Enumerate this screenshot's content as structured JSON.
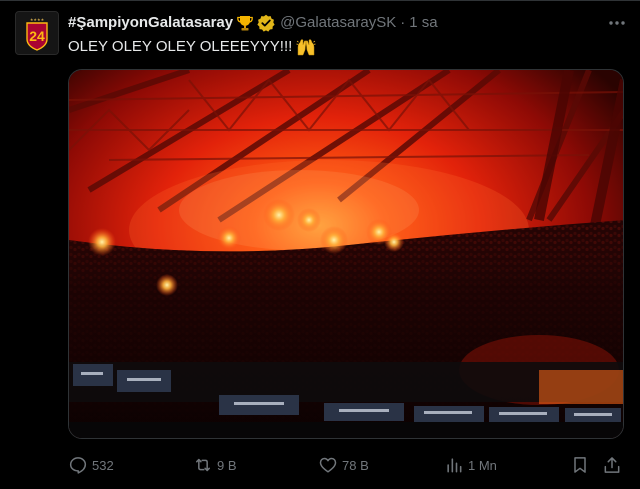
{
  "tweet": {
    "display_name": "#ŞampiyonGalatasaray",
    "handle": "@GalatasaraySK",
    "separator": "·",
    "time": "1 sa",
    "text": "OLEY OLEY OLEY OLEEEYYY!!!",
    "avatar_label": "24",
    "avatar_icon": "galatasaray-24-logo",
    "badge_icon": "trophy-emoji",
    "verified_icon": "gold-verified-badge",
    "text_emoji_icon": "raising-hands-emoji",
    "media": "stadium crowd with red flares photo"
  },
  "actions": {
    "reply_count": "532",
    "retweet_count": "9 B",
    "like_count": "78 B",
    "views_count": "1 Mn"
  },
  "colors": {
    "background": "#000000",
    "primary_text": "#e7e9ea",
    "secondary_text": "#71767b",
    "border": "#2f3336",
    "verified_gold": "#e2b719",
    "brand_red": "#a90432",
    "brand_yellow": "#fdb912"
  }
}
